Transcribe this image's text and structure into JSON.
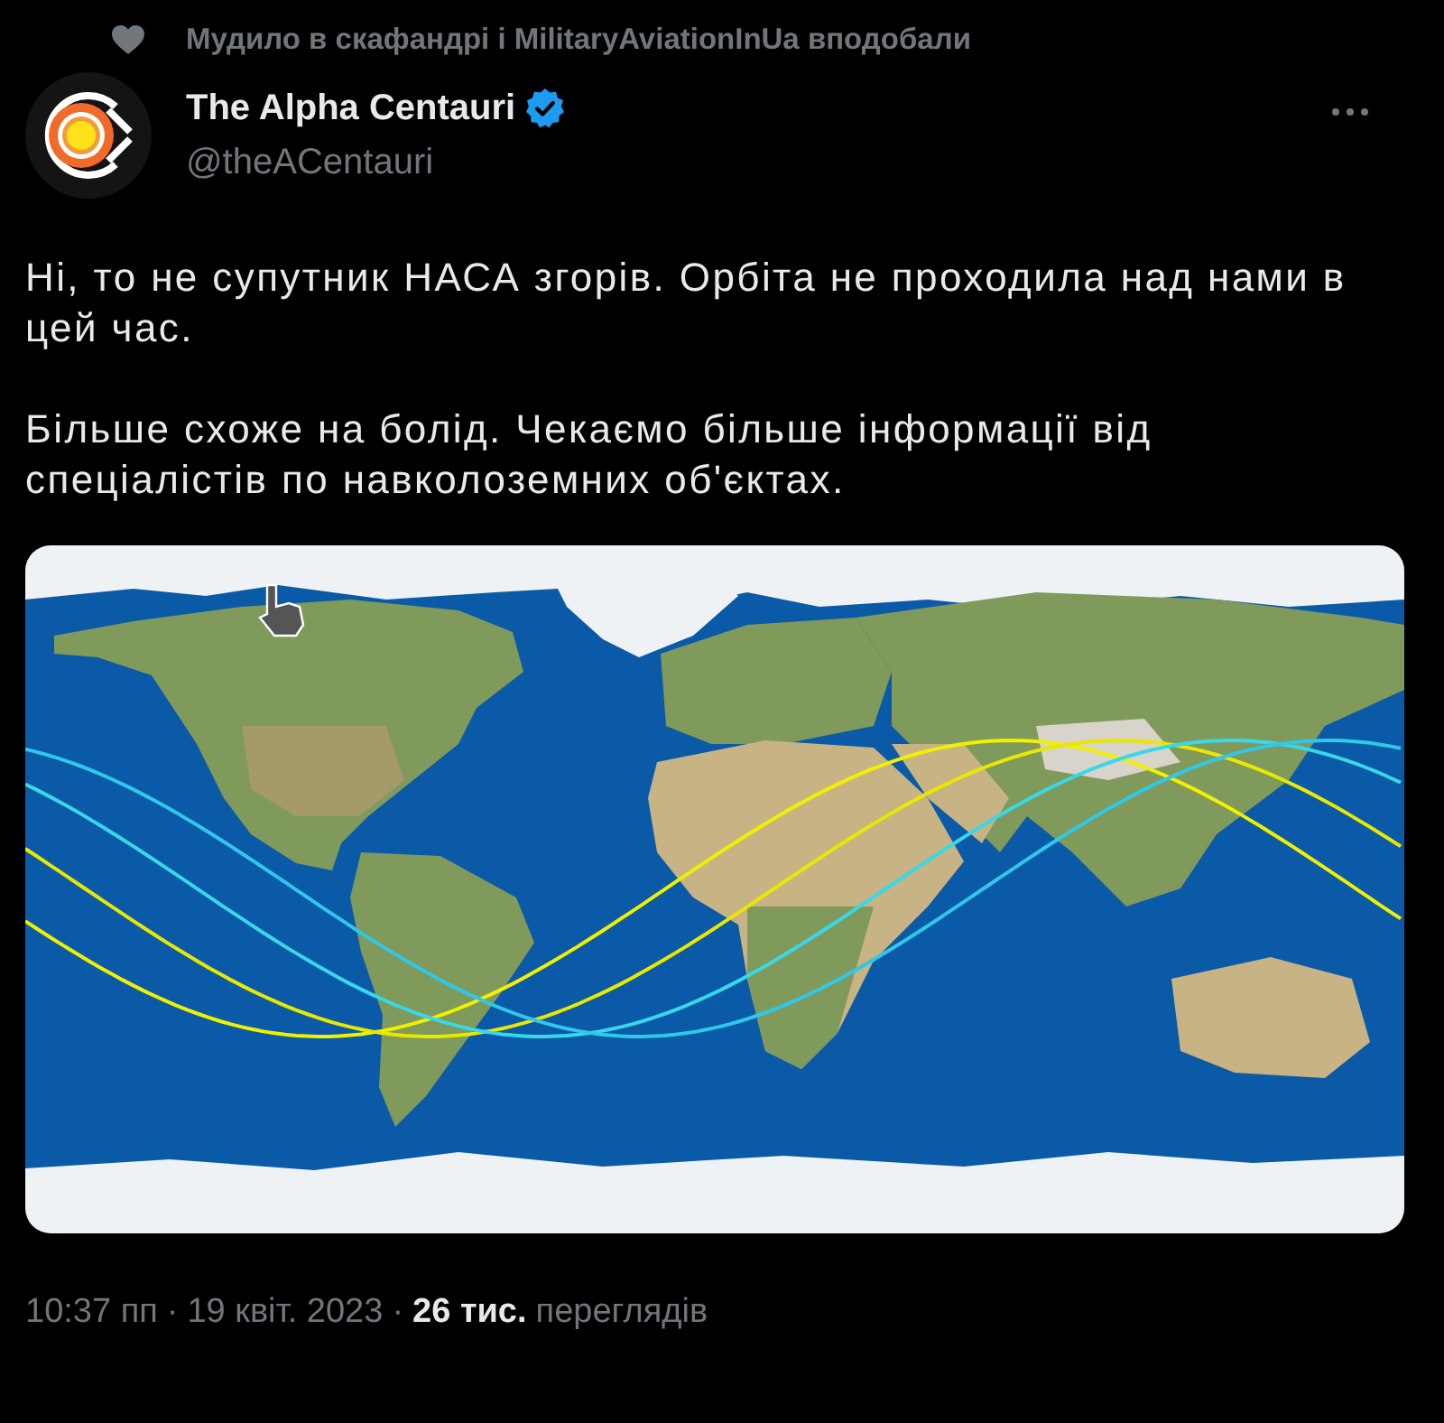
{
  "social_context": {
    "text": "Мудило в скафандрі і MilitaryAviationInUa вподобали"
  },
  "author": {
    "name": "The Alpha Centauri",
    "verified": true,
    "handle": "@theACentauri"
  },
  "tweet": {
    "paragraphs": [
      "Ні, то не супутник НАСА згорів. Орбіта не проходила над нами в цей час.",
      "Більше схоже на болід. Чекаємо більше інформації від спеціалістів по навколоземних об'єктах."
    ]
  },
  "media": {
    "kind": "map"
  },
  "footer": [
    {
      "kind": "time",
      "text": "10:37 пп"
    },
    {
      "kind": "separator",
      "text": "·"
    },
    {
      "kind": "date",
      "text": "19 квіт. 2023"
    },
    {
      "kind": "separator",
      "text": "·"
    },
    {
      "kind": "views_count",
      "text": "26 тис."
    },
    {
      "kind": "views_label",
      "text": "переглядів"
    }
  ]
}
